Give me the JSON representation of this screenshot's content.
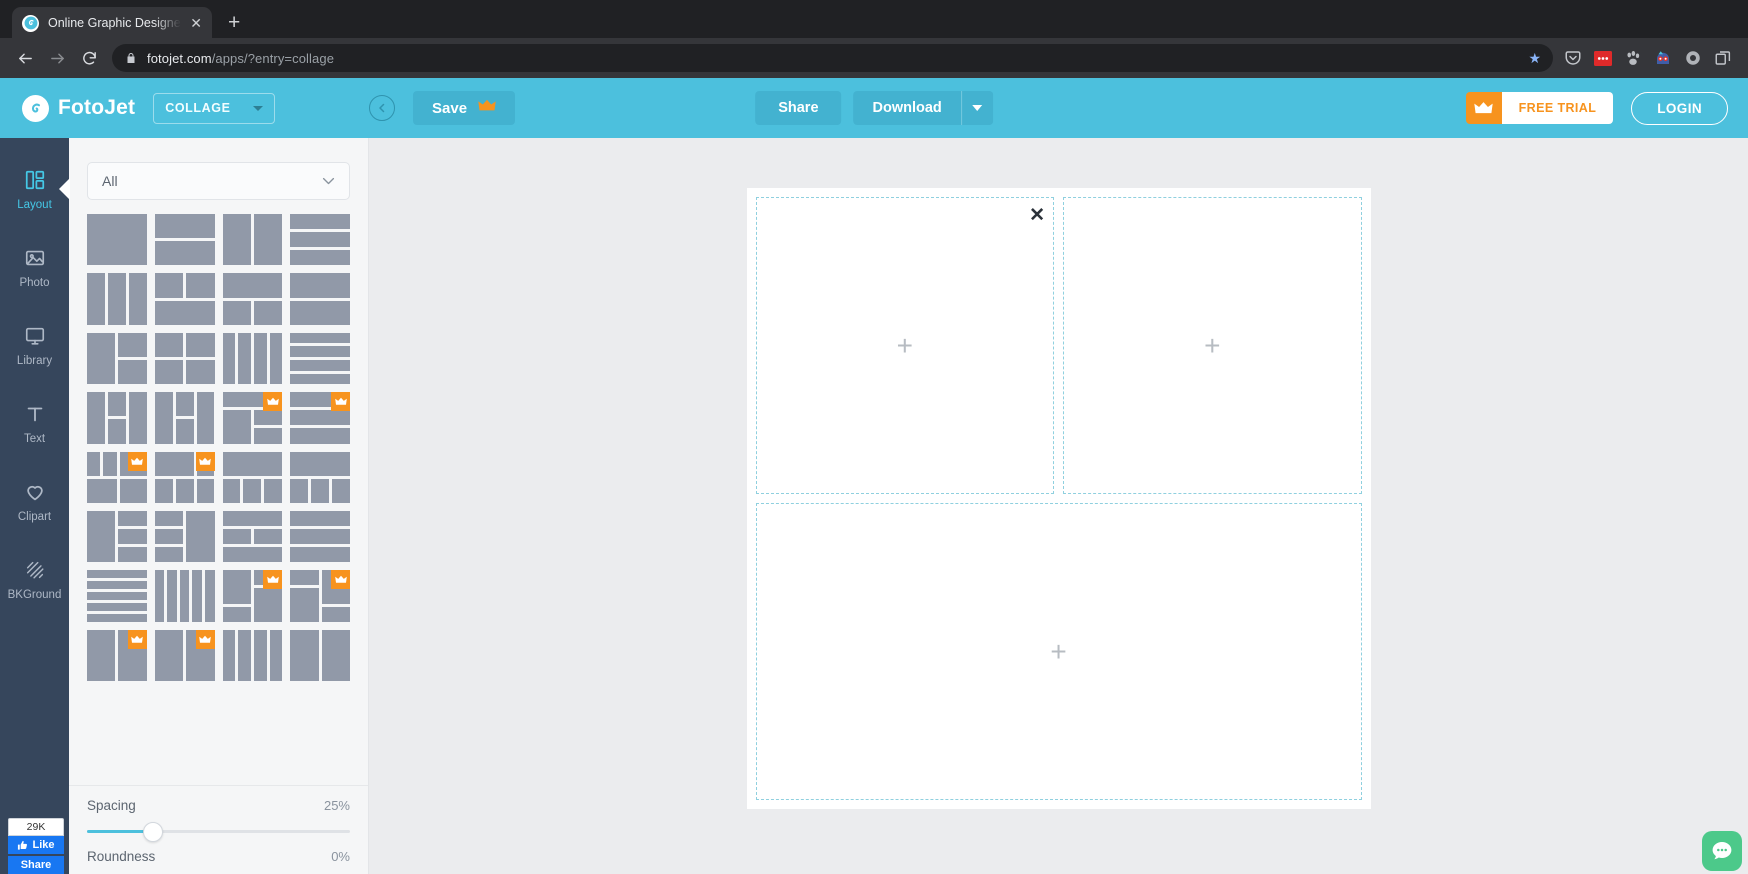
{
  "browser": {
    "tab": {
      "title": "Online Graphic Designer | Collag",
      "favicon": "fotojet-favicon",
      "close_label": "✕"
    },
    "new_tab_label": "+",
    "nav": {
      "back": "←",
      "forward": "→",
      "reload": "↻"
    },
    "omnibox": {
      "lock": "lock-icon",
      "host": "fotojet.com",
      "path": "/apps/?entry=collage",
      "star": "★"
    },
    "extensions": [
      "pocket-icon",
      "adblock-icon",
      "paw-icon",
      "character-icon",
      "circle-icon",
      "tab-copy-icon"
    ]
  },
  "header": {
    "logo_text": "FotoJet",
    "category": {
      "label": "COLLAGE",
      "caret": "chevron-down"
    },
    "back_button": "back-arrow",
    "save_label": "Save",
    "save_crown": "crown-icon",
    "share_label": "Share",
    "download_label": "Download",
    "download_caret": "chevron-down",
    "free_trial_label": "FREE TRIAL",
    "free_trial_crown": "crown-icon",
    "login_label": "LOGIN",
    "accent_color": "#4cc0dd",
    "premium_color": "#f7931e"
  },
  "sidebar": {
    "items": [
      {
        "label": "Layout",
        "icon": "layout-icon",
        "active": true
      },
      {
        "label": "Photo",
        "icon": "photo-icon",
        "active": false
      },
      {
        "label": "Library",
        "icon": "monitor-icon",
        "active": false
      },
      {
        "label": "Text",
        "icon": "text-icon",
        "active": false
      },
      {
        "label": "Clipart",
        "icon": "heart-icon",
        "active": false
      },
      {
        "label": "BKGround",
        "icon": "hatch-icon",
        "active": false
      }
    ],
    "facebook": {
      "count": "29K",
      "like_label": "Like",
      "share_label": "Share"
    }
  },
  "panel": {
    "filter": {
      "value": "All",
      "caret": "chevron-down"
    },
    "layouts": [
      {
        "cols": "1fr",
        "rows": "1fr",
        "cells": [
          {
            "c": "1 / span 1",
            "r": "1 / span 1"
          }
        ],
        "premium": false
      },
      {
        "cols": "1fr",
        "rows": "1fr 1fr",
        "cells": [
          {
            "c": "1",
            "r": "1"
          },
          {
            "c": "1",
            "r": "2"
          }
        ],
        "premium": false
      },
      {
        "cols": "1fr 1fr",
        "rows": "1fr",
        "cells": [
          {
            "c": "1",
            "r": "1"
          },
          {
            "c": "2",
            "r": "1"
          }
        ],
        "premium": false
      },
      {
        "cols": "1fr",
        "rows": "1fr 1fr 1fr",
        "cells": [
          {
            "c": "1",
            "r": "1"
          },
          {
            "c": "1",
            "r": "2"
          },
          {
            "c": "1",
            "r": "3"
          }
        ],
        "premium": false
      },
      {
        "cols": "1fr 1fr 1fr",
        "rows": "1fr",
        "cells": [
          {
            "c": "1",
            "r": "1"
          },
          {
            "c": "2",
            "r": "1"
          },
          {
            "c": "3",
            "r": "1"
          }
        ],
        "premium": false
      },
      {
        "cols": "1fr 1fr",
        "rows": "1fr 1fr",
        "cells": [
          {
            "c": "1",
            "r": "1"
          },
          {
            "c": "2",
            "r": "1"
          },
          {
            "c": "1 / span 2",
            "r": "2"
          }
        ],
        "premium": false
      },
      {
        "cols": "1fr 1fr",
        "rows": "1fr 1fr",
        "cells": [
          {
            "c": "1 / span 2",
            "r": "1"
          },
          {
            "c": "1",
            "r": "2"
          },
          {
            "c": "2",
            "r": "2"
          }
        ],
        "premium": false
      },
      {
        "cols": "1fr",
        "rows": "1fr 1fr",
        "cells": [
          {
            "c": "1",
            "r": "1"
          },
          {
            "c": "1",
            "r": "2"
          }
        ],
        "premium": false
      },
      {
        "cols": "1fr 1fr",
        "rows": "1fr 1fr",
        "cells": [
          {
            "c": "1",
            "r": "1 / span 2"
          },
          {
            "c": "2",
            "r": "1"
          },
          {
            "c": "2",
            "r": "2"
          }
        ],
        "premium": false
      },
      {
        "cols": "1fr 1fr",
        "rows": "1fr 1fr",
        "cells": [
          {
            "c": "1",
            "r": "1"
          },
          {
            "c": "2",
            "r": "1"
          },
          {
            "c": "1",
            "r": "2"
          },
          {
            "c": "2",
            "r": "2"
          }
        ],
        "premium": false
      },
      {
        "cols": "1fr 1fr 1fr 1fr",
        "rows": "1fr",
        "cells": [
          {
            "c": "1",
            "r": "1"
          },
          {
            "c": "2",
            "r": "1"
          },
          {
            "c": "3",
            "r": "1"
          },
          {
            "c": "4",
            "r": "1"
          }
        ],
        "premium": false
      },
      {
        "cols": "1fr",
        "rows": "1fr 1fr 1fr 1fr",
        "cells": [
          {
            "c": "1",
            "r": "1"
          },
          {
            "c": "1",
            "r": "2"
          },
          {
            "c": "1",
            "r": "3"
          },
          {
            "c": "1",
            "r": "4"
          }
        ],
        "premium": false
      },
      {
        "cols": "1fr 1fr 1fr",
        "rows": "1fr 1fr",
        "cells": [
          {
            "c": "1",
            "r": "1 / span 2"
          },
          {
            "c": "2",
            "r": "1"
          },
          {
            "c": "2",
            "r": "2"
          },
          {
            "c": "3",
            "r": "1 / span 2"
          }
        ],
        "premium": false
      },
      {
        "cols": "1fr 1fr 1fr",
        "rows": "1fr 1fr",
        "cells": [
          {
            "c": "1",
            "r": "1 / span 2"
          },
          {
            "c": "2",
            "r": "1"
          },
          {
            "c": "2",
            "r": "2"
          },
          {
            "c": "3",
            "r": "1 / span 2"
          }
        ],
        "premium": false
      },
      {
        "cols": "1fr 1fr",
        "rows": "1fr 1fr 1fr",
        "cells": [
          {
            "c": "1 / span 2",
            "r": "1"
          },
          {
            "c": "1",
            "r": "2 / span 2"
          },
          {
            "c": "2",
            "r": "2"
          },
          {
            "c": "2",
            "r": "3"
          }
        ],
        "premium": true
      },
      {
        "cols": "1fr",
        "rows": "1fr 1fr 1fr",
        "cells": [
          {
            "c": "1",
            "r": "1"
          },
          {
            "c": "1",
            "r": "2"
          },
          {
            "c": "1",
            "r": "3"
          }
        ],
        "premium": true
      },
      {
        "cols": "1fr 1fr 2fr",
        "rows": "1fr 1fr",
        "cells": [
          {
            "c": "1",
            "r": "1"
          },
          {
            "c": "2",
            "r": "1"
          },
          {
            "c": "3",
            "r": "1"
          },
          {
            "c": "1 / span 2",
            "r": "2"
          },
          {
            "c": "3",
            "r": "2"
          }
        ],
        "premium": true
      },
      {
        "cols": "1fr 1fr 1fr",
        "rows": "1fr 1fr",
        "cells": [
          {
            "c": "1 / span 2",
            "r": "1"
          },
          {
            "c": "3",
            "r": "1"
          },
          {
            "c": "1",
            "r": "2"
          },
          {
            "c": "2",
            "r": "2"
          },
          {
            "c": "3",
            "r": "2"
          }
        ],
        "premium": true
      },
      {
        "cols": "1fr 1fr 1fr",
        "rows": "1fr 1fr",
        "cells": [
          {
            "c": "1 / span 3",
            "r": "1"
          },
          {
            "c": "1",
            "r": "2"
          },
          {
            "c": "2",
            "r": "2"
          },
          {
            "c": "3",
            "r": "2"
          }
        ],
        "premium": false
      },
      {
        "cols": "1fr 1fr 1fr",
        "rows": "1fr 1fr",
        "cells": [
          {
            "c": "1 / span 3",
            "r": "1"
          },
          {
            "c": "1",
            "r": "2"
          },
          {
            "c": "2",
            "r": "2"
          },
          {
            "c": "3",
            "r": "2"
          }
        ],
        "premium": false
      },
      {
        "cols": "1fr 1fr",
        "rows": "1fr 1fr 1fr",
        "cells": [
          {
            "c": "1",
            "r": "1 / span 3"
          },
          {
            "c": "2",
            "r": "1"
          },
          {
            "c": "2",
            "r": "2"
          },
          {
            "c": "2",
            "r": "3"
          }
        ],
        "premium": false
      },
      {
        "cols": "1fr 1fr",
        "rows": "1fr 1fr 1fr",
        "cells": [
          {
            "c": "1",
            "r": "1"
          },
          {
            "c": "1",
            "r": "2"
          },
          {
            "c": "1",
            "r": "3"
          },
          {
            "c": "2",
            "r": "1 / span 3"
          }
        ],
        "premium": false
      },
      {
        "cols": "1fr 1fr",
        "rows": "1fr 1fr 1fr",
        "cells": [
          {
            "c": "1 / span 2",
            "r": "1"
          },
          {
            "c": "1",
            "r": "2"
          },
          {
            "c": "2",
            "r": "2"
          },
          {
            "c": "1 / span 2",
            "r": "3"
          }
        ],
        "premium": false
      },
      {
        "cols": "1fr",
        "rows": "1fr 1fr 1fr",
        "cells": [
          {
            "c": "1",
            "r": "1"
          },
          {
            "c": "1",
            "r": "2"
          },
          {
            "c": "1",
            "r": "3"
          }
        ],
        "premium": false
      },
      {
        "cols": "1fr",
        "rows": "1fr 1fr 1fr 1fr 1fr",
        "cells": [
          {
            "c": "1",
            "r": "1"
          },
          {
            "c": "1",
            "r": "2"
          },
          {
            "c": "1",
            "r": "3"
          },
          {
            "c": "1",
            "r": "4"
          },
          {
            "c": "1",
            "r": "5"
          }
        ],
        "premium": false
      },
      {
        "cols": "1fr 1fr 1fr 1fr 1fr",
        "rows": "1fr",
        "cells": [
          {
            "c": "1",
            "r": "1"
          },
          {
            "c": "2",
            "r": "1"
          },
          {
            "c": "3",
            "r": "1"
          },
          {
            "c": "4",
            "r": "1"
          },
          {
            "c": "5",
            "r": "1"
          }
        ],
        "premium": false
      },
      {
        "cols": "1fr 1fr",
        "rows": "1fr 1fr 1fr",
        "cells": [
          {
            "c": "1",
            "r": "1 / span 2"
          },
          {
            "c": "2",
            "r": "1"
          },
          {
            "c": "2",
            "r": "2 / span 2"
          },
          {
            "c": "1",
            "r": "3"
          }
        ],
        "premium": true
      },
      {
        "cols": "1fr 1fr",
        "rows": "1fr 1fr 1fr",
        "cells": [
          {
            "c": "1",
            "r": "1"
          },
          {
            "c": "2",
            "r": "1 / span 2"
          },
          {
            "c": "1",
            "r": "2 / span 2"
          },
          {
            "c": "2",
            "r": "3"
          }
        ],
        "premium": true
      },
      {
        "cols": "1fr 1fr",
        "rows": "1fr",
        "cells": [
          {
            "c": "1",
            "r": "1"
          },
          {
            "c": "2",
            "r": "1"
          }
        ],
        "premium": true
      },
      {
        "cols": "1fr 1fr",
        "rows": "1fr",
        "cells": [
          {
            "c": "1",
            "r": "1"
          },
          {
            "c": "2",
            "r": "1"
          }
        ],
        "premium": true
      },
      {
        "cols": "1fr 1fr 1fr 1fr",
        "rows": "1fr",
        "cells": [
          {
            "c": "1",
            "r": "1"
          },
          {
            "c": "2",
            "r": "1"
          },
          {
            "c": "3",
            "r": "1"
          },
          {
            "c": "4",
            "r": "1"
          }
        ],
        "premium": false
      },
      {
        "cols": "1fr 1fr",
        "rows": "1fr",
        "cells": [
          {
            "c": "1",
            "r": "1"
          },
          {
            "c": "2",
            "r": "1"
          }
        ],
        "premium": false
      }
    ],
    "spacing": {
      "label": "Spacing",
      "value": "25%",
      "percent": 25
    },
    "roundness": {
      "label": "Roundness",
      "value": "0%",
      "percent": 0
    }
  },
  "canvas": {
    "slots": [
      {
        "placeholder": "+",
        "closable": true
      },
      {
        "placeholder": "+",
        "closable": false
      },
      {
        "placeholder": "+",
        "closable": false,
        "wide": true
      }
    ],
    "close_label": "✕",
    "border_color": "#8fd0df",
    "background": "#ebecee"
  },
  "chat_widget": {
    "icon": "chat-bubble-icon",
    "color": "#4cc98a"
  }
}
